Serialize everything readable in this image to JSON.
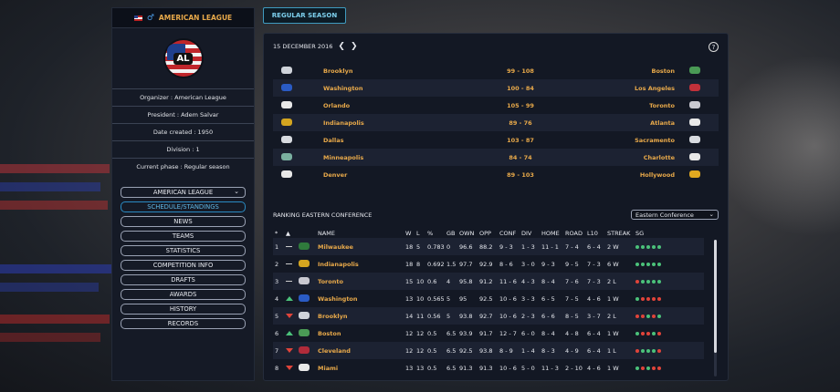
{
  "league": {
    "name": "AMERICAN LEAGUE",
    "logo_text": "AL",
    "organizer": "Organizer : American League",
    "president": "President : Adem Salvar",
    "date_created": "Date created : 1950",
    "division": "Division : 1",
    "current_phase": "Current phase : Regular season"
  },
  "nav": {
    "select_value": "AMERICAN LEAGUE",
    "items": [
      "SCHEDULE/STANDINGS",
      "NEWS",
      "TEAMS",
      "STATISTICS",
      "COMPETITION INFO",
      "DRAFTS",
      "AWARDS",
      "HISTORY",
      "RECORDS"
    ],
    "active_index": 0
  },
  "tab": {
    "label": "REGULAR SEASON"
  },
  "schedule": {
    "date": "15 DECEMBER 2016",
    "help": "?",
    "games": [
      {
        "home": "Brooklyn",
        "score": "99 - 108",
        "away": "Boston",
        "home_color": "#cfd3da",
        "away_color": "#4a9a55"
      },
      {
        "home": "Washington",
        "score": "100 - 84",
        "away": "Los Angeles",
        "home_color": "#2a5bc4",
        "away_color": "#c2313a"
      },
      {
        "home": "Orlando",
        "score": "105 - 99",
        "away": "Toronto",
        "home_color": "#e8e8e8",
        "away_color": "#c9c9d1"
      },
      {
        "home": "Indianapolis",
        "score": "89 - 76",
        "away": "Atlanta",
        "home_color": "#d4a520",
        "away_color": "#e8e8e8"
      },
      {
        "home": "Dallas",
        "score": "103 - 87",
        "away": "Sacramento",
        "home_color": "#d8dbe0",
        "away_color": "#d8dbe0"
      },
      {
        "home": "Minneapolis",
        "score": "84 - 74",
        "away": "Charlotte",
        "home_color": "#7ab0a0",
        "away_color": "#e8e8e8"
      },
      {
        "home": "Denver",
        "score": "89 - 103",
        "away": "Hollywood",
        "home_color": "#e8e8e8",
        "away_color": "#e0a820"
      }
    ]
  },
  "standings": {
    "title": "RANKING EASTERN CONFERENCE",
    "conference_select": "Eastern Conference",
    "headers": {
      "rank": "*",
      "sort": "▲",
      "name": "NAME",
      "w": "W",
      "l": "L",
      "pct": "%",
      "gb": "GB",
      "own": "OWN",
      "opp": "OPP",
      "conf": "CONF",
      "div": "DIV",
      "home": "HOME",
      "road": "ROAD",
      "l10": "L10",
      "streak": "STREAK",
      "sg": "SG"
    },
    "rows": [
      {
        "rank": "1",
        "move": "same",
        "name": "Milwaukee",
        "logo_color": "#2f7a3c",
        "w": "18",
        "l": "5",
        "pct": "0.783",
        "gb": "0",
        "own": "96.6",
        "opp": "88.2",
        "conf": "9 - 3",
        "div": "1 - 3",
        "home": "11 - 1",
        "road": "7 - 4",
        "l10": "6 - 4",
        "streak": "2 W",
        "sg": [
          "w",
          "w",
          "w",
          "w",
          "w"
        ]
      },
      {
        "rank": "2",
        "move": "same",
        "name": "Indianapolis",
        "logo_color": "#d4a520",
        "w": "18",
        "l": "8",
        "pct": "0.692",
        "gb": "1.5",
        "own": "97.7",
        "opp": "92.9",
        "conf": "8 - 6",
        "div": "3 - 0",
        "home": "9 - 3",
        "road": "9 - 5",
        "l10": "7 - 3",
        "streak": "6 W",
        "sg": [
          "w",
          "w",
          "w",
          "w",
          "w"
        ]
      },
      {
        "rank": "3",
        "move": "same",
        "name": "Toronto",
        "logo_color": "#c9c9d1",
        "w": "15",
        "l": "10",
        "pct": "0.6",
        "gb": "4",
        "own": "95.8",
        "opp": "91.2",
        "conf": "11 - 6",
        "div": "4 - 3",
        "home": "8 - 4",
        "road": "7 - 6",
        "l10": "7 - 3",
        "streak": "2 L",
        "sg": [
          "l",
          "w",
          "w",
          "w",
          "w"
        ]
      },
      {
        "rank": "4",
        "move": "up",
        "name": "Washington",
        "logo_color": "#2a5bc4",
        "w": "13",
        "l": "10",
        "pct": "0.565",
        "gb": "5",
        "own": "95",
        "opp": "92.5",
        "conf": "10 - 6",
        "div": "3 - 3",
        "home": "6 - 5",
        "road": "7 - 5",
        "l10": "4 - 6",
        "streak": "1 W",
        "sg": [
          "w",
          "l",
          "l",
          "l",
          "l"
        ]
      },
      {
        "rank": "5",
        "move": "down",
        "name": "Brooklyn",
        "logo_color": "#cfd3da",
        "w": "14",
        "l": "11",
        "pct": "0.56",
        "gb": "5",
        "own": "93.8",
        "opp": "92.7",
        "conf": "10 - 6",
        "div": "2 - 3",
        "home": "6 - 6",
        "road": "8 - 5",
        "l10": "3 - 7",
        "streak": "2 L",
        "sg": [
          "l",
          "l",
          "w",
          "l",
          "w"
        ]
      },
      {
        "rank": "6",
        "move": "up",
        "name": "Boston",
        "logo_color": "#4a9a55",
        "w": "12",
        "l": "12",
        "pct": "0.5",
        "gb": "6.5",
        "own": "93.9",
        "opp": "91.7",
        "conf": "12 - 7",
        "div": "6 - 0",
        "home": "8 - 4",
        "road": "4 - 8",
        "l10": "6 - 4",
        "streak": "1 W",
        "sg": [
          "w",
          "l",
          "l",
          "w",
          "l"
        ]
      },
      {
        "rank": "7",
        "move": "down",
        "name": "Cleveland",
        "logo_color": "#b02b3a",
        "w": "12",
        "l": "12",
        "pct": "0.5",
        "gb": "6.5",
        "own": "92.5",
        "opp": "93.8",
        "conf": "8 - 9",
        "div": "1 - 4",
        "home": "8 - 3",
        "road": "4 - 9",
        "l10": "6 - 4",
        "streak": "1 L",
        "sg": [
          "l",
          "w",
          "w",
          "w",
          "l"
        ]
      },
      {
        "rank": "8",
        "move": "down",
        "name": "Miami",
        "logo_color": "#e8e8e8",
        "w": "13",
        "l": "13",
        "pct": "0.5",
        "gb": "6.5",
        "own": "91.3",
        "opp": "91.3",
        "conf": "10 - 6",
        "div": "5 - 0",
        "home": "11 - 3",
        "road": "2 - 10",
        "l10": "4 - 6",
        "streak": "1 W",
        "sg": [
          "w",
          "l",
          "w",
          "l",
          "l"
        ]
      }
    ]
  },
  "colors": {
    "accent": "#e8a94a",
    "tab": "#7dd0ee",
    "win": "#4bc27a",
    "loss": "#e0443a"
  }
}
